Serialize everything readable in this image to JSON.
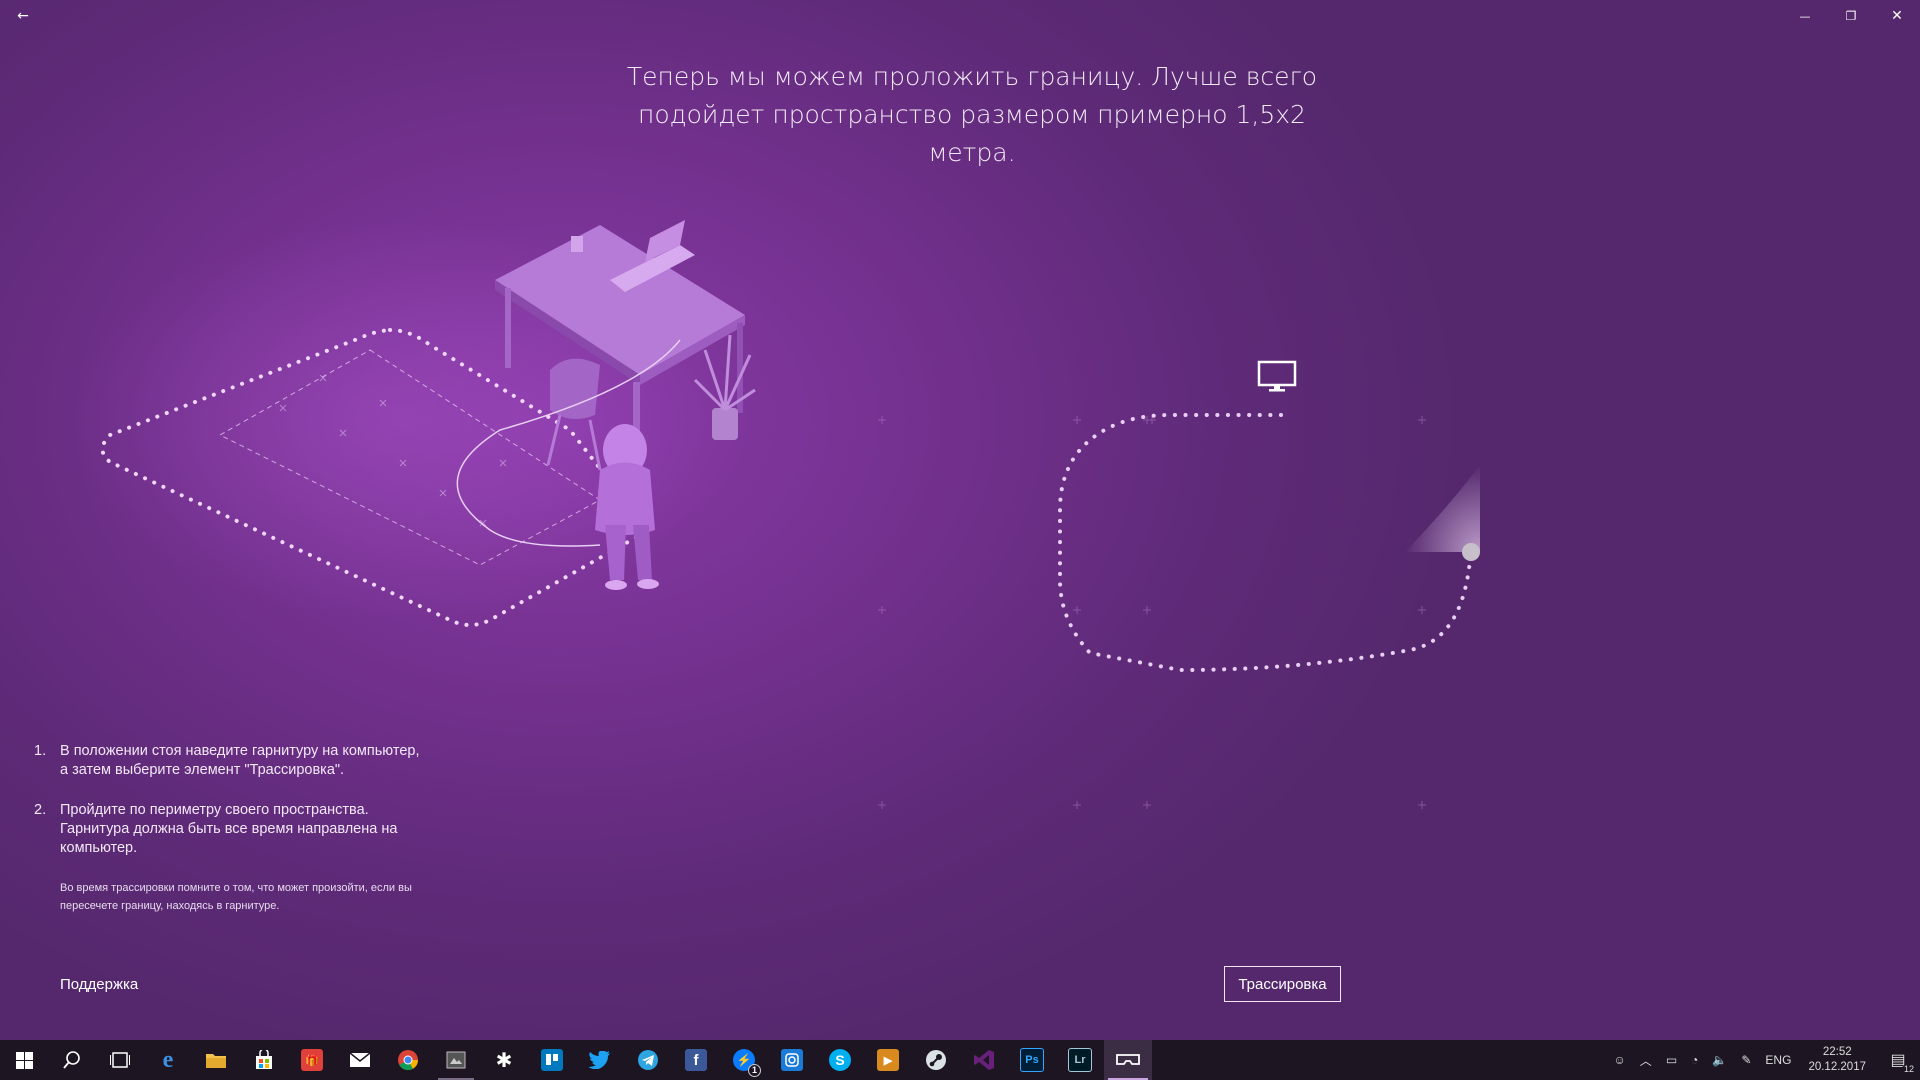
{
  "window": {
    "back_glyph": "←",
    "minimize_glyph": "—",
    "maximize_glyph": "❐",
    "close_glyph": "✕"
  },
  "headline": "Теперь мы можем проложить границу. Лучше всего подойдет пространство размером примерно 1,5x2 метра.",
  "instructions": {
    "steps": [
      {
        "num": "1.",
        "text": "В положении стоя наведите гарнитуру на компьютер, а затем выберите элемент \"Трассировка\"."
      },
      {
        "num": "2.",
        "text": "Пройдите по периметру своего пространства. Гарнитура должна быть все время направлена на компьютер."
      }
    ],
    "note": "Во время трассировки помните о том, что может произойти, если вы пересечете границу, находясь в гарнитуре."
  },
  "support_label": "Поддержка",
  "trace_button_label": "Трассировка",
  "colors": {
    "background": "#74318f",
    "accent": "#c9a6e0",
    "taskbar": "#1d1622"
  },
  "taskbar": {
    "apps": [
      {
        "name": "start",
        "icon": "windows-logo-icon"
      },
      {
        "name": "search",
        "icon": "search-icon"
      },
      {
        "name": "task-view",
        "icon": "task-view-icon"
      },
      {
        "name": "edge",
        "icon": "edge-icon"
      },
      {
        "name": "explorer",
        "icon": "folder-icon"
      },
      {
        "name": "store",
        "icon": "store-icon"
      },
      {
        "name": "gift",
        "icon": "gift-icon"
      },
      {
        "name": "mail",
        "icon": "mail-icon"
      },
      {
        "name": "chrome",
        "icon": "chrome-icon"
      },
      {
        "name": "app-window",
        "icon": "window-app-icon"
      },
      {
        "name": "slack",
        "icon": "slack-icon"
      },
      {
        "name": "trello",
        "icon": "trello-icon"
      },
      {
        "name": "twitter",
        "icon": "twitter-icon"
      },
      {
        "name": "telegram",
        "icon": "telegram-icon"
      },
      {
        "name": "facebook",
        "icon": "facebook-icon"
      },
      {
        "name": "messenger",
        "icon": "messenger-icon"
      },
      {
        "name": "instagram",
        "icon": "instagram-icon"
      },
      {
        "name": "skype",
        "icon": "skype-icon"
      },
      {
        "name": "media-player",
        "icon": "play-icon"
      },
      {
        "name": "steam",
        "icon": "steam-icon"
      },
      {
        "name": "visual-studio",
        "icon": "visual-studio-icon"
      },
      {
        "name": "photoshop",
        "icon": "photoshop-icon"
      },
      {
        "name": "lightroom",
        "icon": "lightroom-icon"
      },
      {
        "name": "mixed-reality-portal",
        "icon": "vr-headset-icon"
      }
    ],
    "photoshop_label": "Ps",
    "lightroom_label": "Lr",
    "facebook_label": "f",
    "messenger_badge": "1",
    "tray": {
      "language": "ENG",
      "time": "22:52",
      "date": "20.12.2017",
      "notification_count": "12"
    }
  }
}
